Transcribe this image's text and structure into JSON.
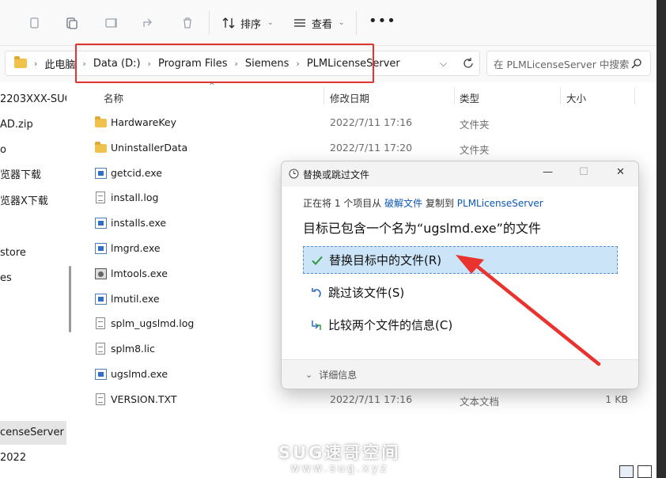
{
  "toolbar": {
    "sort_label": "排序",
    "view_label": "查看",
    "more_label": "•••"
  },
  "address": {
    "crumbs": [
      "此电脑",
      "Data (D:)",
      "Program Files",
      "Siemens",
      "PLMLicenseServer"
    ],
    "search_placeholder": "在 PLMLicenseServer 中搜索"
  },
  "nav": {
    "items": [
      "2203XXX-SUG",
      "AD.zip",
      "o",
      "览器下载",
      "览器X下载",
      "store",
      "es",
      "censeServer",
      "2022"
    ]
  },
  "columns": {
    "name": "名称",
    "date": "修改日期",
    "type": "类型",
    "size": "大小"
  },
  "files": [
    {
      "name": "HardwareKey",
      "date": "2022/7/11 17:16",
      "type": "文件夹",
      "size": "",
      "icon": "folder"
    },
    {
      "name": "UninstallerData",
      "date": "2022/7/11 17:20",
      "type": "文件夹",
      "size": "",
      "icon": "folder"
    },
    {
      "name": "getcid.exe",
      "date": "",
      "type": "",
      "size": "",
      "icon": "exe"
    },
    {
      "name": "install.log",
      "date": "",
      "type": "",
      "size": "",
      "icon": "doc"
    },
    {
      "name": "installs.exe",
      "date": "",
      "type": "",
      "size": "",
      "icon": "exe"
    },
    {
      "name": "lmgrd.exe",
      "date": "",
      "type": "",
      "size": "",
      "icon": "exe"
    },
    {
      "name": "lmtools.exe",
      "date": "",
      "type": "",
      "size": "",
      "icon": "tool"
    },
    {
      "name": "lmutil.exe",
      "date": "",
      "type": "",
      "size": "",
      "icon": "exe"
    },
    {
      "name": "splm_ugslmd.log",
      "date": "",
      "type": "",
      "size": "",
      "icon": "doc"
    },
    {
      "name": "splm8.lic",
      "date": "",
      "type": "",
      "size": "",
      "icon": "doc"
    },
    {
      "name": "ugslmd.exe",
      "date": "",
      "type": "",
      "size": "",
      "icon": "exe"
    },
    {
      "name": "VERSION.TXT",
      "date": "2022/7/11 17:16",
      "type": "文本文档",
      "size": "1 KB",
      "icon": "doc"
    }
  ],
  "dialog": {
    "title": "替换或跳过文件",
    "line1_prefix": "正在将 1 个项目从",
    "line1_source": "破解文件",
    "line1_mid": "复制到",
    "line1_dest": "PLMLicenseServer",
    "line2": "目标已包含一个名为“ugslmd.exe”的文件",
    "opt_replace": "替换目标中的文件(R)",
    "opt_skip": "跳过该文件(S)",
    "opt_compare": "比较两个文件的信息(C)",
    "details": "详细信息",
    "minimize": "—",
    "maximize": "☐",
    "close": "✕"
  },
  "watermark": {
    "line1": "SUG速哥空间",
    "line2": "www.sug.xyz"
  },
  "colors": {
    "accent": "#0b58b8",
    "highlight_red": "#e0322f",
    "selected_option": "#cce4f7",
    "check_green": "#2e9a3c"
  }
}
